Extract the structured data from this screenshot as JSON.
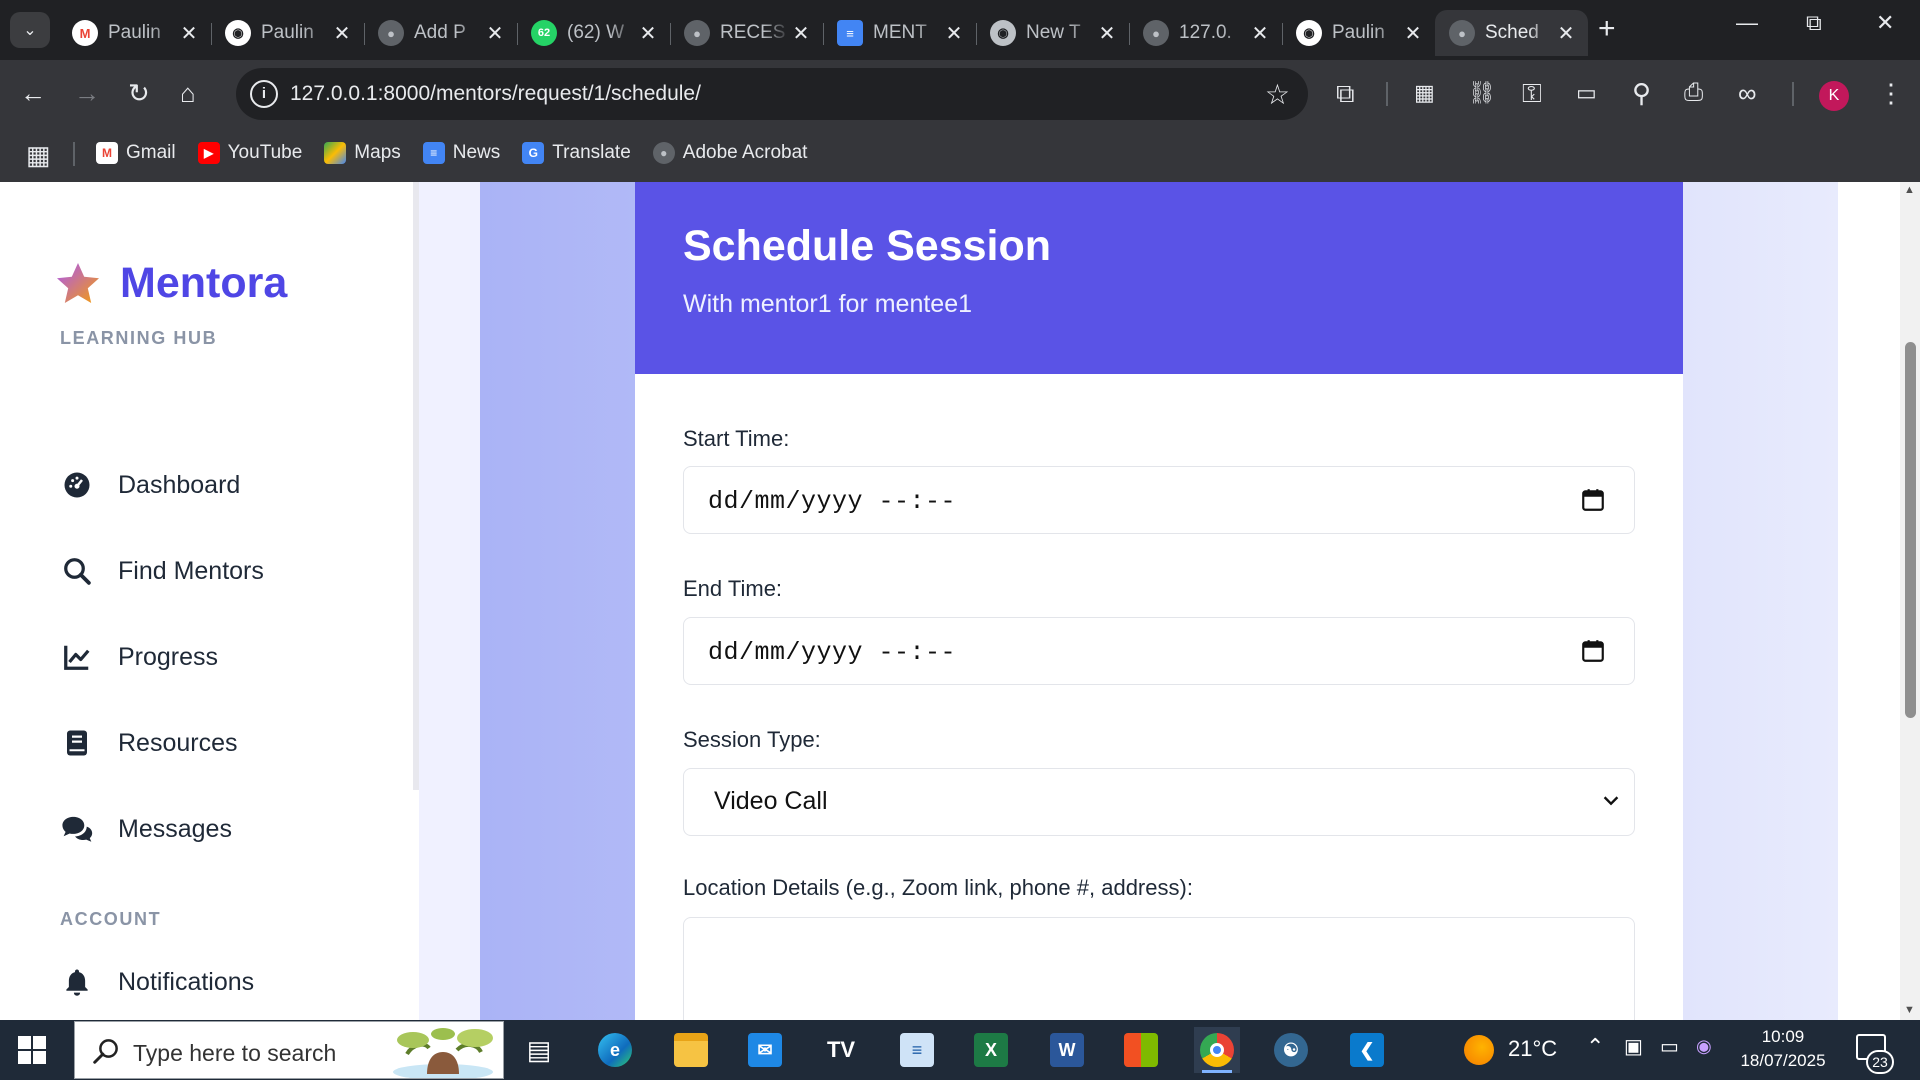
{
  "browser": {
    "tabs": [
      {
        "title": "Paulin",
        "favicon": "gmail-icon",
        "active": false
      },
      {
        "title": "Paulin",
        "favicon": "github-icon",
        "active": false
      },
      {
        "title": "Add P",
        "favicon": "globe-icon",
        "active": false
      },
      {
        "title": "(62) W",
        "favicon": "whatsapp-icon",
        "badge": "62",
        "active": false
      },
      {
        "title": "RECES",
        "favicon": "globe-icon",
        "active": false
      },
      {
        "title": "MENT",
        "favicon": "docs-icon",
        "active": false
      },
      {
        "title": "New T",
        "favicon": "chrome-icon",
        "active": false
      },
      {
        "title": "127.0.",
        "favicon": "globe-icon",
        "active": false
      },
      {
        "title": "Paulin",
        "favicon": "github-icon",
        "active": false
      },
      {
        "title": "Sched",
        "favicon": "globe-icon",
        "active": true
      }
    ],
    "url": "127.0.0.1:8000/mentors/request/1/schedule/",
    "profile_initial": "K",
    "bookmarks": [
      {
        "label": "Gmail",
        "icon": "gmail-icon",
        "color": "#ea4335"
      },
      {
        "label": "YouTube",
        "icon": "youtube-icon",
        "color": "#ff0000"
      },
      {
        "label": "Maps",
        "icon": "maps-icon",
        "color": "#34a853"
      },
      {
        "label": "News",
        "icon": "news-icon",
        "color": "#4285f4"
      },
      {
        "label": "Translate",
        "icon": "translate-icon",
        "color": "#4285f4"
      },
      {
        "label": "Adobe Acrobat",
        "icon": "globe-icon",
        "color": "#5f6368"
      }
    ]
  },
  "sidebar": {
    "brand": "Mentora",
    "sections": [
      {
        "heading": "LEARNING HUB",
        "items": [
          {
            "label": "Dashboard",
            "icon": "dashboard-gauge-icon"
          },
          {
            "label": "Find Mentors",
            "icon": "search-icon"
          },
          {
            "label": "Progress",
            "icon": "line-chart-icon"
          },
          {
            "label": "Resources",
            "icon": "book-icon"
          },
          {
            "label": "Messages",
            "icon": "chat-bubbles-icon"
          }
        ]
      },
      {
        "heading": "ACCOUNT",
        "items": [
          {
            "label": "Notifications",
            "icon": "bell-icon"
          }
        ]
      }
    ]
  },
  "form": {
    "title": "Schedule Session",
    "subtitle": "With mentor1 for mentee1",
    "start_label": "Start Time:",
    "start_value": "dd/mm/yyyy --:--",
    "end_label": "End Time:",
    "end_value": "dd/mm/yyyy --:--",
    "session_type_label": "Session Type:",
    "session_type_value": "Video Call",
    "location_label": "Location Details (e.g., Zoom link, phone #, address):",
    "location_value": ""
  },
  "taskbar": {
    "search_placeholder": "Type here to search",
    "temperature": "21°C",
    "time": "10:09",
    "date": "18/07/2025",
    "notification_count": "23"
  },
  "colors": {
    "accent": "#5a53e6",
    "brand_text": "#4f46e5"
  }
}
